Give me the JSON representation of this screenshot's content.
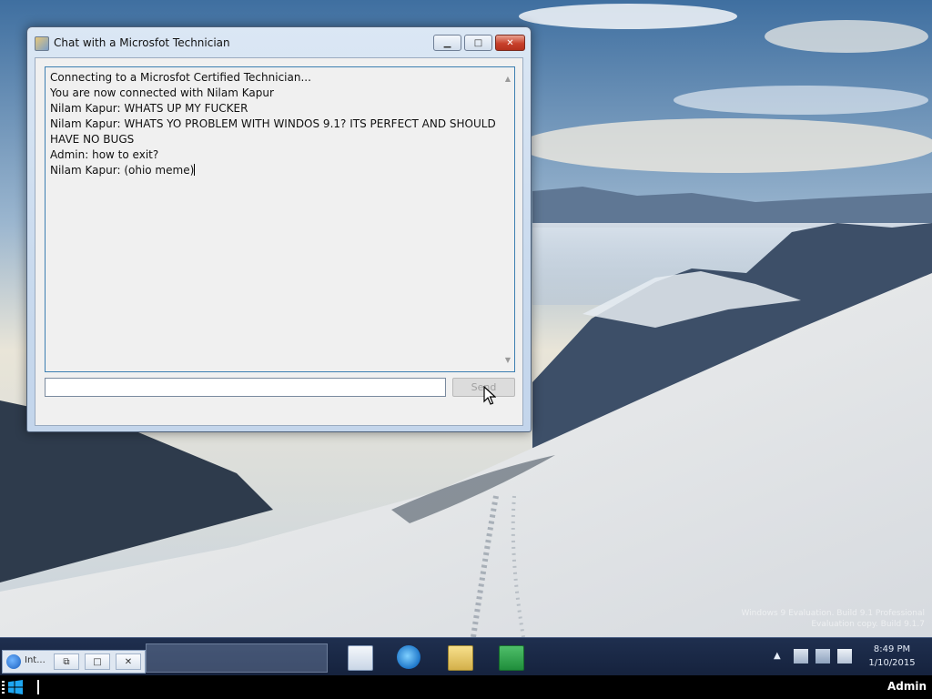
{
  "window": {
    "title": "Chat with a Microsfot Technician",
    "icon": "chat-app-icon",
    "controls": {
      "minimize_icon": "minimize-icon",
      "maximize_icon": "maximize-icon",
      "close_icon": "close-icon",
      "minimize_glyph": "▁",
      "maximize_glyph": "□",
      "close_glyph": "✕"
    }
  },
  "chat": {
    "messages": [
      "Connecting to a Microsfot Certified Technician...",
      "You are now connected with Nilam Kapur",
      "Nilam Kapur: WHATS UP MY FUCKER",
      "Nilam Kapur: WHATS YO PROBLEM WITH WINDOS 9.1? ITS PERFECT AND SHOULD HAVE NO BUGS",
      "Admin: how to exit?",
      "Nilam Kapur: (ohio meme)"
    ],
    "input_value": "",
    "send_label": "Send"
  },
  "desktop": {
    "watermark_line1": "Windows 9 Evaluation. Build 9.1 Professional",
    "watermark_line2": "Evaluation copy. Build 9.1.7"
  },
  "taskbar": {
    "search_placeholder": "",
    "pinned": [
      "explorer-window-icon",
      "internet-explorer-icon",
      "file-explorer-icon",
      "store-icon"
    ],
    "clock_time": "8:49 PM",
    "clock_date": "1/10/2015",
    "show_hidden_icons_glyph": "▲"
  },
  "mini_toolbar": {
    "label": "Int...",
    "restore_glyph": "⧉",
    "maximize_glyph": "□",
    "close_glyph": "✕"
  },
  "bottom_bar": {
    "user": "Admin"
  },
  "colors": {
    "window_frame": "#c9daee",
    "close_button": "#c8402b",
    "chat_border": "#3c7fb1",
    "taskbar": "#1a2846",
    "bottom_bar": "#000000"
  }
}
